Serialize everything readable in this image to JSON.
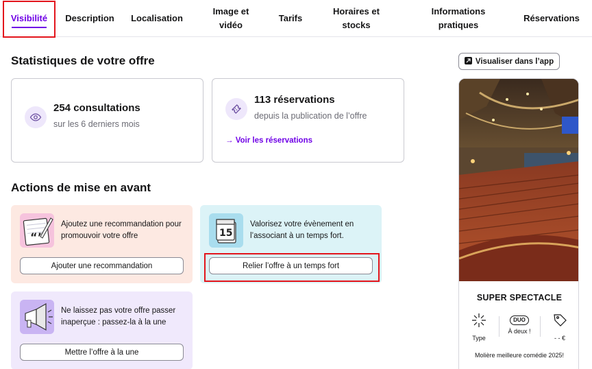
{
  "tabs": [
    {
      "label": "Visibilité",
      "active": true
    },
    {
      "label": "Description"
    },
    {
      "label": "Localisation"
    },
    {
      "label": "Image et vidéo"
    },
    {
      "label": "Tarifs"
    },
    {
      "label": "Horaires et stocks"
    },
    {
      "label": "Informations pratiques"
    },
    {
      "label": "Réservations"
    }
  ],
  "stats": {
    "heading": "Statistiques de votre offre",
    "consultations": {
      "title": "254 consultations",
      "subtitle": "sur les 6 derniers mois",
      "icon": "eye-icon"
    },
    "reservations": {
      "title": "113 réservations",
      "subtitle": "depuis la publication de l’offre",
      "link": "Voir les réservations",
      "link_arrow": "→",
      "icon": "ticket-icon"
    }
  },
  "actions": {
    "heading": "Actions de mise en avant",
    "recommendation": {
      "text": "Ajoutez une recommandation pour promouvoir votre offre",
      "button": "Ajouter une recommandation",
      "icon": "notepad-quote-icon",
      "bg": "#fde9e2"
    },
    "highlight": {
      "text": "Valorisez votre évènement en l’associant à un temps fort.",
      "button": "Relier l’offre à un temps fort",
      "icon": "calendar-icon",
      "calendar_day": "15",
      "bg": "#dcf3f7"
    },
    "headline": {
      "text": "Ne laissez pas votre offre passer inaperçue : passez-la à la une",
      "button": "Mettre l’offre à la une",
      "icon": "megaphone-icon",
      "bg": "#f0e9fc"
    }
  },
  "preview": {
    "button": "Visualiser dans l’app",
    "title": "SUPER SPECTACLE",
    "pills": [
      {
        "label": "Type",
        "icon": "sparkle-icon"
      },
      {
        "label": "À deux !",
        "icon": "duo-icon",
        "badge": "DUO"
      },
      {
        "label": "- - €",
        "icon": "price-tag-icon"
      }
    ],
    "description": "Molière meilleure comédie 2025!"
  },
  "colors": {
    "accent": "#6f00e6",
    "highlight_box": "#e3141b",
    "text": "#161617",
    "muted": "#6b6b74"
  }
}
